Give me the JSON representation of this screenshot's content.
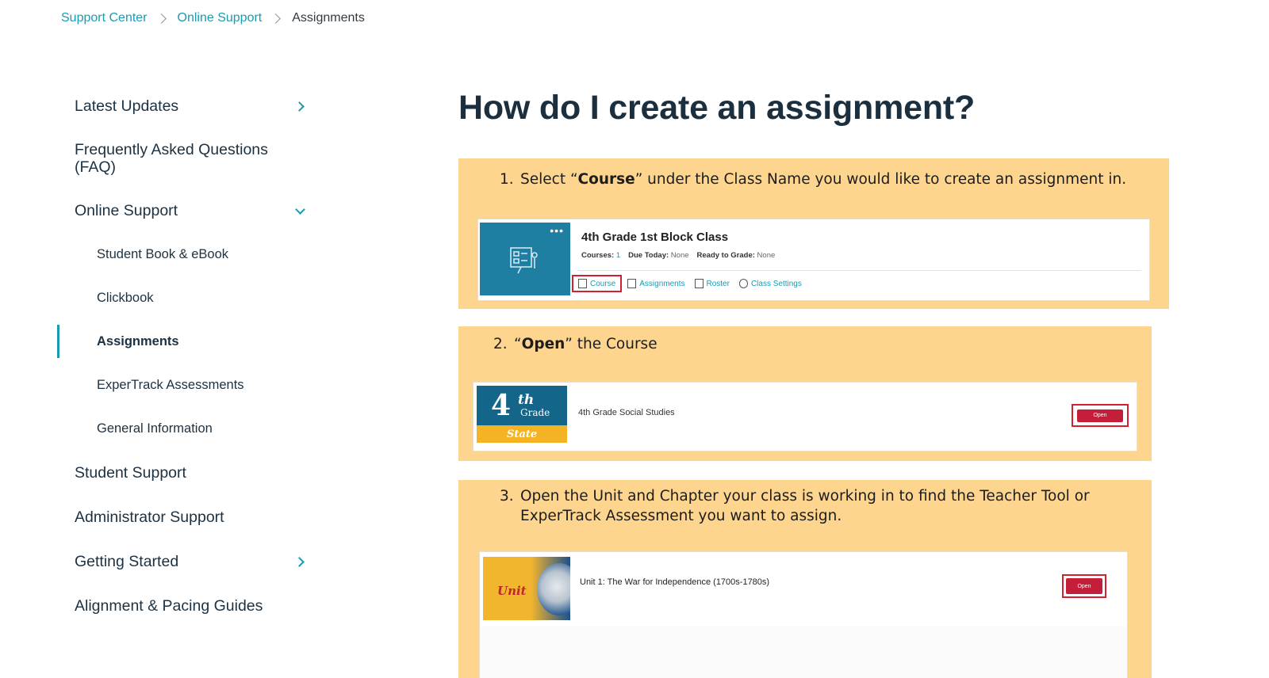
{
  "breadcrumb": {
    "items": [
      "Support Center",
      "Online Support"
    ],
    "current": "Assignments"
  },
  "sidebar": {
    "items": [
      {
        "label": "Latest Updates"
      },
      {
        "label": "Frequently Asked Questions (FAQ)"
      },
      {
        "label": "Online Support"
      },
      {
        "label": "Student Support"
      },
      {
        "label": "Administrator Support"
      },
      {
        "label": "Getting Started"
      },
      {
        "label": "Alignment & Pacing Guides"
      }
    ],
    "subitems": [
      {
        "label": "Student Book & eBook"
      },
      {
        "label": "Clickbook"
      },
      {
        "label": "Assignments",
        "active": true
      },
      {
        "label": "ExperTrack Assessments"
      },
      {
        "label": "General Information"
      }
    ]
  },
  "main": {
    "title": "How do I create an assignment?",
    "steps": [
      {
        "number": "1.",
        "pre": "Select “",
        "bold": "Course",
        "post": "” under the Class Name you would like to create an assignment in.",
        "card": {
          "class_name": "4th Grade 1st Block Class",
          "meta": [
            {
              "label": "Courses:",
              "value": "1"
            },
            {
              "label": "Due Today:",
              "value": "None"
            },
            {
              "label": "Ready to Grade:",
              "value": "None"
            }
          ],
          "links": [
            "Course",
            "Assignments",
            "Roster",
            "Class Settings"
          ],
          "dots": "•••"
        }
      },
      {
        "number": "2.",
        "pre": "“",
        "bold": "Open",
        "post": "” the Course",
        "card": {
          "thumb_number": "4",
          "thumb_suffix": "th",
          "thumb_word": "Grade",
          "thumb_state": "State",
          "course_name": "4th Grade Social Studies",
          "button": "Open"
        }
      },
      {
        "number": "3.",
        "line1": "Open the Unit and Chapter your class is working in to find the Teacher Tool or",
        "line2": "ExperTrack Assessment you want to assign.",
        "card": {
          "thumb_word": "Unit",
          "unit_name": "Unit 1: The War for Independence (1700s-1780s)",
          "button": "Open"
        }
      }
    ]
  },
  "colors": {
    "accent": "#1a9bb0",
    "step_bg": "#fdd58e",
    "highlight": "#d4202e",
    "open_button": "#c51e3a"
  }
}
